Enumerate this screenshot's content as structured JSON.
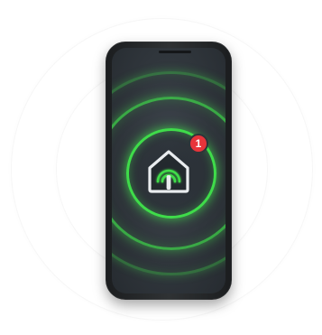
{
  "illustration": {
    "subject": "smartphone-with-smart-home-app",
    "badge": {
      "count": "1",
      "color": "#e8343a"
    },
    "colors": {
      "accent_green": "#3fdc4a",
      "screen_dark": "#30363c",
      "phone_body": "#2a2d30",
      "house_outline": "#e9ecef"
    },
    "icons": {
      "app_icon": "home-wifi-icon"
    }
  }
}
